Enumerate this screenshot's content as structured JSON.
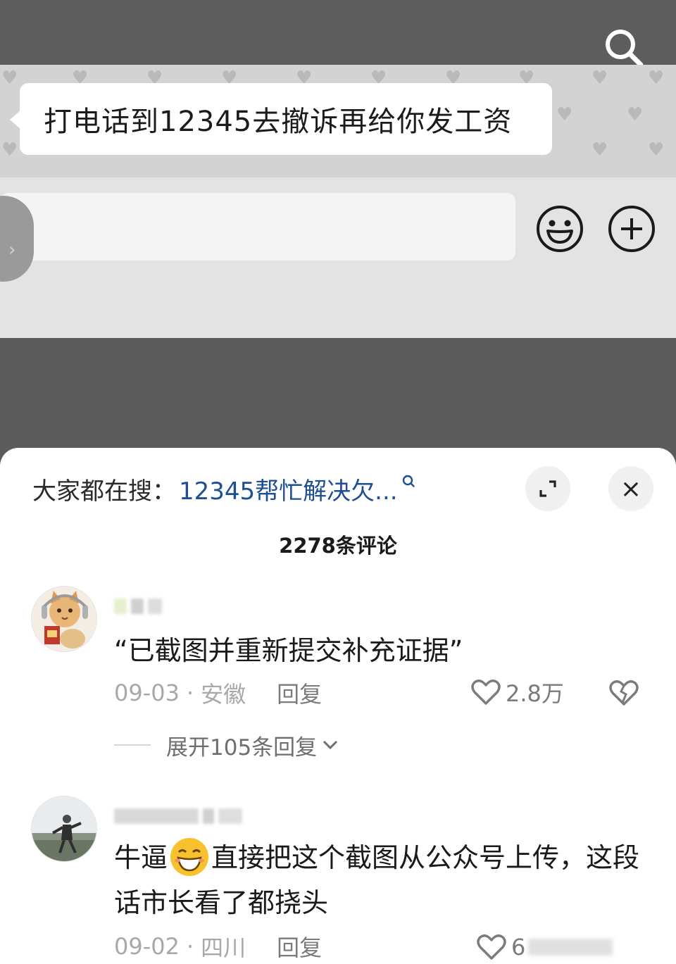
{
  "chat": {
    "message": "打电话到12345去撤诉再给你发工资"
  },
  "icons": {
    "search": "search-icon",
    "emoji": "emoji-icon",
    "plus": "plus-icon",
    "expand": "expand-icon",
    "close": "close-icon",
    "like": "heart-icon",
    "dislike": "broken-heart-icon"
  },
  "panel": {
    "search_prefix": "大家都在搜：",
    "search_term": "12345帮忙解决欠...",
    "close_label": "×",
    "comment_count": "2278条评论"
  },
  "comments": [
    {
      "text": "“已截图并重新提交补充证据”",
      "date": "09-03",
      "dot": "·",
      "location": "安徽",
      "reply_label": "回复",
      "likes": "2.8万",
      "expand_replies": "展开105条回复"
    },
    {
      "text_part1": "牛逼",
      "text_part2": "直接把这个截图从公众号上传，这段话市长看了都挠头",
      "date": "09-02",
      "dot": "·",
      "location": "四川",
      "reply_label": "回复",
      "likes": "6"
    }
  ],
  "colors": {
    "link_blue": "#1e4f93",
    "panel_bg": "#ffffff",
    "video_bg": "#5b5b5b"
  }
}
